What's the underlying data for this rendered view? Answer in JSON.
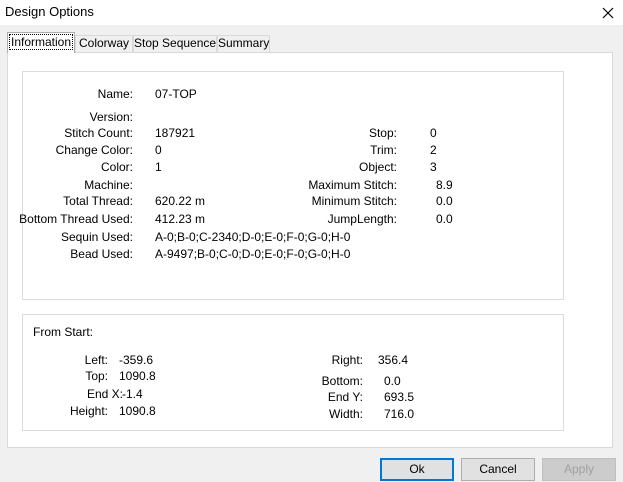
{
  "window": {
    "title": "Design Options"
  },
  "tabs": [
    "Information",
    "Colorway",
    "Stop Sequence",
    "Summary"
  ],
  "info": {
    "name": {
      "label": "Name:",
      "value": "07-TOP"
    },
    "version": {
      "label": "Version:",
      "value": ""
    },
    "stitch_count": {
      "label": "Stitch Count:",
      "value": "187921"
    },
    "change_color": {
      "label": "Change Color:",
      "value": "0"
    },
    "color": {
      "label": "Color:",
      "value": "1"
    },
    "machine": {
      "label": "Machine:",
      "value": ""
    },
    "total_thread": {
      "label": "Total Thread:",
      "value": "620.22 m"
    },
    "bottom_thread": {
      "label": "Bottom Thread Used:",
      "value": "412.23 m"
    },
    "sequin": {
      "label": "Sequin Used:",
      "value": "A-0;B-0;C-2340;D-0;E-0;F-0;G-0;H-0"
    },
    "bead": {
      "label": "Bead Used:",
      "value": "A-9497;B-0;C-0;D-0;E-0;F-0;G-0;H-0"
    },
    "stop": {
      "label": "Stop:",
      "value": "0"
    },
    "trim": {
      "label": "Trim:",
      "value": "2"
    },
    "object": {
      "label": "Object:",
      "value": "3"
    },
    "max_stitch": {
      "label": "Maximum Stitch:",
      "value": "8.9"
    },
    "min_stitch": {
      "label": "Minimum Stitch:",
      "value": "0.0"
    },
    "jump_length": {
      "label": "JumpLength:",
      "value": "0.0"
    }
  },
  "from_start": {
    "heading": "From Start:",
    "left": {
      "label": "Left:",
      "value": "-359.6"
    },
    "top": {
      "label": "Top:",
      "value": "1090.8"
    },
    "end_x": {
      "label": "End X:",
      "value": "-1.4"
    },
    "height": {
      "label": "Height:",
      "value": "1090.8"
    },
    "right": {
      "label": "Right:",
      "value": "356.4"
    },
    "bottom": {
      "label": "Bottom:",
      "value": "0.0"
    },
    "end_y": {
      "label": "End Y:",
      "value": "693.5"
    },
    "width": {
      "label": "Width:",
      "value": "716.0"
    }
  },
  "buttons": {
    "ok": "Ok",
    "cancel": "Cancel",
    "apply": "Apply"
  }
}
